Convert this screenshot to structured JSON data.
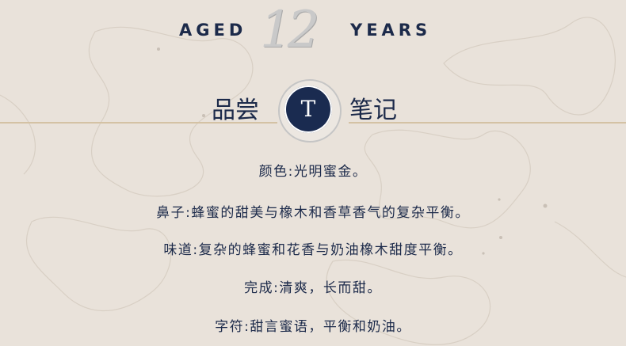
{
  "header": {
    "left_word": "AGED",
    "number": "12",
    "right_word": "YEARS"
  },
  "section": {
    "title_left": "品尝",
    "title_right": "笔记",
    "badge_letter": "T"
  },
  "notes": [
    "颜色:光明蜜金。",
    "鼻子:蜂蜜的甜美与橡木和香草香气的复杂平衡。",
    "味道:复杂的蜂蜜和花香与奶油橡木甜度平衡。",
    "完成:清爽，长而甜。",
    "字符:甜言蜜语，平衡和奶油。"
  ],
  "colors": {
    "background": "#e9e2da",
    "navy": "#1c2a4a",
    "silver": "#c9c9c9",
    "gold_rule": "#d4c2a4"
  }
}
